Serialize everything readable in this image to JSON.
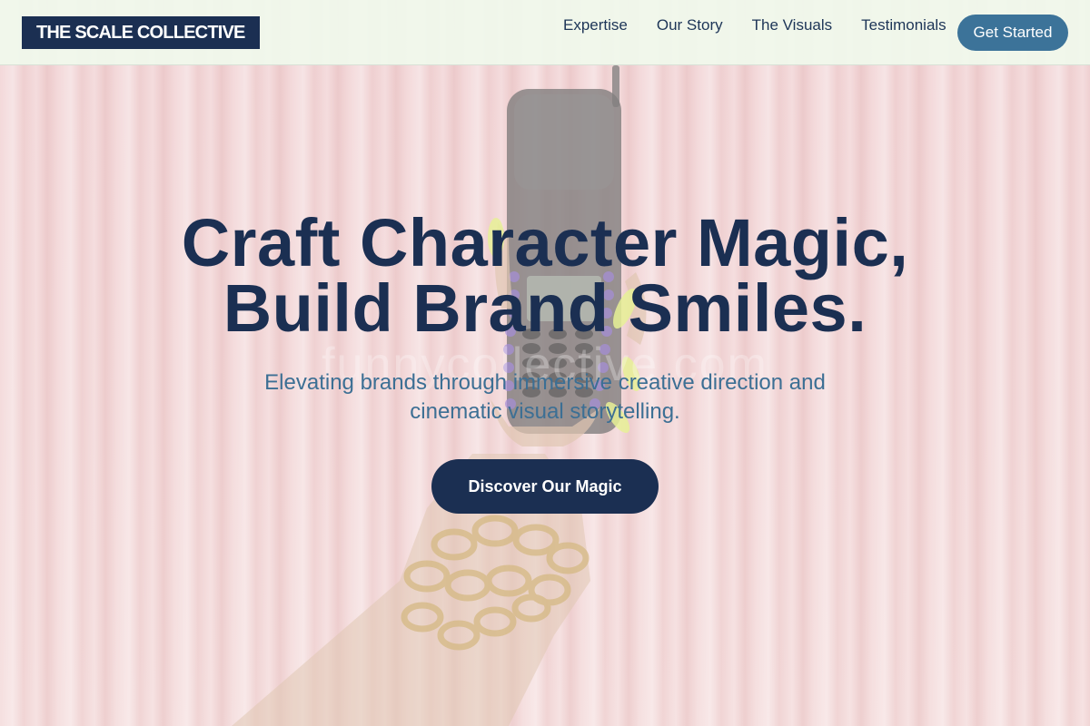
{
  "header": {
    "logo_text": "THE SCALE COLLECTIVE",
    "nav": [
      {
        "label": "Expertise"
      },
      {
        "label": "Our Story"
      },
      {
        "label": "The Visuals"
      },
      {
        "label": "Testimonials"
      }
    ],
    "cta_label": "Get Started"
  },
  "hero": {
    "title_line1": "Craft Character Magic,",
    "title_line2": "Build Brand Smiles.",
    "subtitle": "Elevating brands through immersive creative direction and cinematic visual storytelling.",
    "button_label": "Discover Our Magic",
    "watermark": "funnycollective.com"
  },
  "colors": {
    "navy": "#1b2f52",
    "steel_blue": "#3c7399",
    "header_bg": "#f0f9ec",
    "curtain_pink": "#f2d2d4"
  },
  "icons": {
    "hero_image": "hand-holding-mobile-phone"
  }
}
